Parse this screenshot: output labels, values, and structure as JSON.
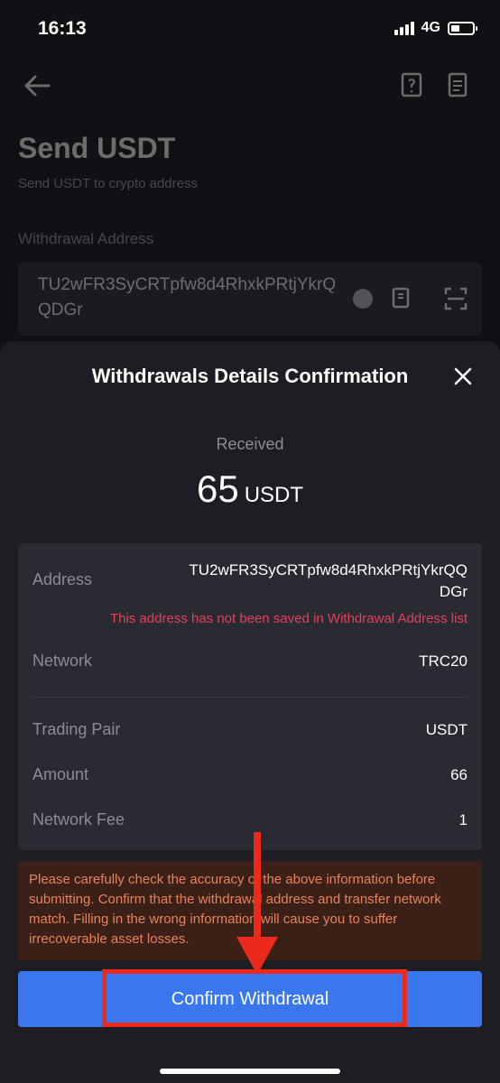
{
  "status_bar": {
    "time": "16:13",
    "network": "4G"
  },
  "page": {
    "title": "Send USDT",
    "subtitle": "Send USDT to crypto address",
    "address_label": "Withdrawal Address",
    "address_value": "TU2wFR3SyCRTpfw8d4RhxkPRtjYkrQQDGr"
  },
  "modal": {
    "title": "Withdrawals Details Confirmation",
    "received_label": "Received",
    "received_amount": "65",
    "received_unit": "USDT",
    "details": {
      "address_label": "Address",
      "address_value": "TU2wFR3SyCRTpfw8d4RhxkPRtjYkrQQDGr",
      "address_warning": "This address has not been saved in Withdrawal Address list",
      "network_label": "Network",
      "network_value": "TRC20",
      "pair_label": "Trading Pair",
      "pair_value": "USDT",
      "amount_label": "Amount",
      "amount_value": "66",
      "fee_label": "Network Fee",
      "fee_value": "1"
    },
    "warning": "Please carefully check the accuracy of the above information before submitting. Confirm that the withdrawal address and transfer network match. Filling in the wrong information will cause you to suffer irrecoverable asset losses.",
    "confirm_label": "Confirm Withdrawal"
  },
  "colors": {
    "accent": "#3a77ee",
    "warning_text": "#e8825b",
    "error_text": "#e5415c",
    "annotation": "#ec2a1c"
  }
}
